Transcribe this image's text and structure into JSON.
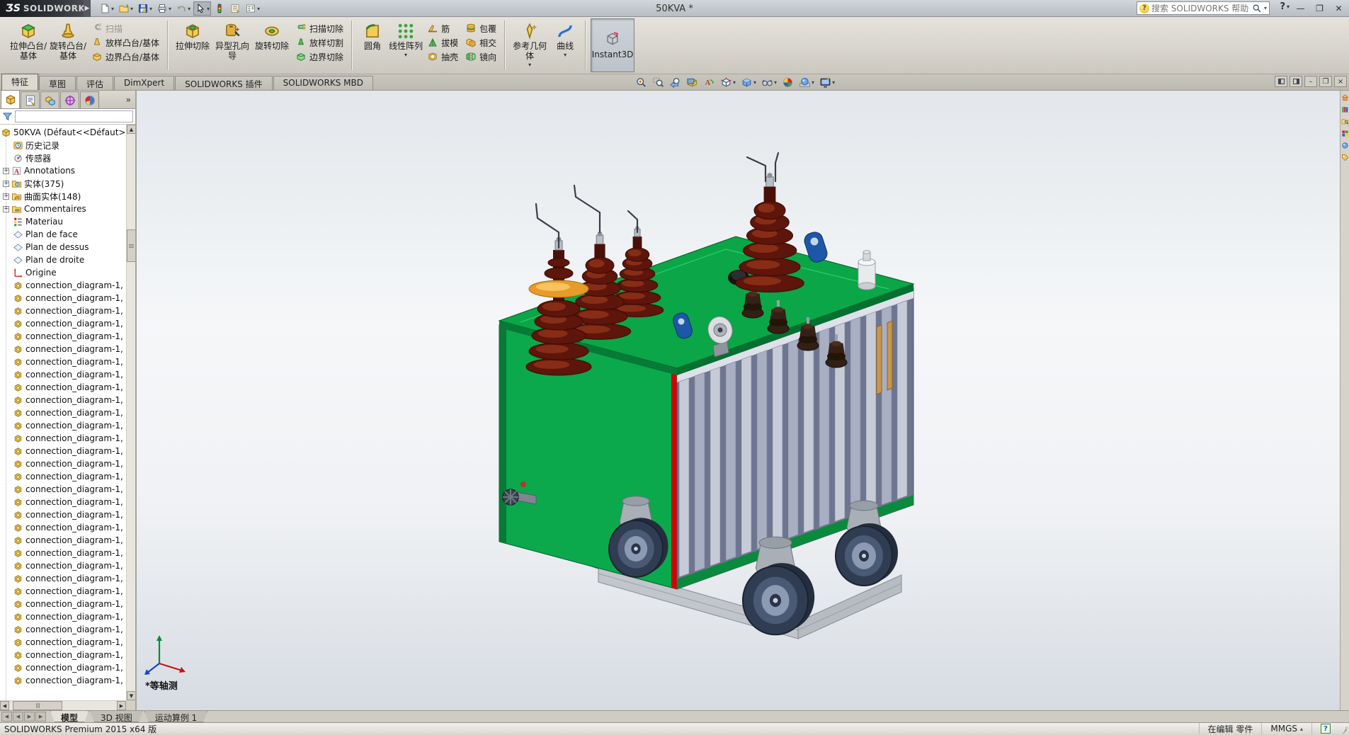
{
  "titlebar": {
    "logo_mark": "ƷS",
    "logo_text": "SOLIDWORKS",
    "title": "50KVA *",
    "tools": [
      {
        "name": "new-document",
        "icon": "new",
        "dropdown": true
      },
      {
        "name": "open",
        "icon": "open",
        "dropdown": true
      },
      {
        "name": "save",
        "icon": "save",
        "dropdown": true
      },
      {
        "name": "print",
        "icon": "print",
        "dropdown": true
      },
      {
        "name": "undo",
        "icon": "undo",
        "dropdown": true
      },
      {
        "name": "select",
        "icon": "select",
        "dropdown": true,
        "pressed": true
      },
      {
        "name": "appearance",
        "icon": "appearance",
        "dropdown": false
      },
      {
        "name": "edit-properties",
        "icon": "props",
        "dropdown": false
      },
      {
        "name": "options",
        "icon": "options",
        "dropdown": true
      }
    ],
    "search": {
      "placeholder": "搜索 SOLIDWORKS 帮助"
    },
    "help_label": "?",
    "window_buttons": [
      "minimize",
      "restore",
      "close"
    ]
  },
  "ribbon": {
    "groups": [
      {
        "big": [
          {
            "label": "拉伸凸台/基体"
          },
          {
            "label": "旋转凸台/基体"
          }
        ],
        "smalls": [
          [
            {
              "label": "扫描",
              "disabled": true
            },
            {
              "label": "放样凸台/基体"
            },
            {
              "label": "边界凸台/基体"
            }
          ]
        ]
      },
      {
        "big": [
          {
            "label": "拉伸切除"
          },
          {
            "label": "异型孔向导"
          },
          {
            "label": "旋转切除"
          }
        ],
        "smalls": [
          [
            {
              "label": "扫描切除"
            },
            {
              "label": "放样切割"
            },
            {
              "label": "边界切除"
            }
          ]
        ]
      },
      {
        "big": [
          {
            "label": "圆角"
          },
          {
            "label": "线性阵列"
          }
        ],
        "smalls": [
          [
            {
              "label": "筋"
            },
            {
              "label": "拔模"
            },
            {
              "label": "抽壳"
            }
          ],
          [
            {
              "label": "包覆"
            },
            {
              "label": "相交"
            },
            {
              "label": "镜向"
            }
          ]
        ]
      },
      {
        "big": [
          {
            "label": "参考几何体"
          },
          {
            "label": "曲线"
          }
        ]
      }
    ],
    "instant3d": {
      "label": "Instant3D",
      "active": true
    }
  },
  "command_tabs": {
    "items": [
      "特征",
      "草图",
      "评估",
      "DimXpert",
      "SOLIDWORKS 插件",
      "SOLIDWORKS MBD"
    ],
    "active_index": 0
  },
  "doc_controls": [
    {
      "name": "pane-left"
    },
    {
      "name": "pane-right"
    },
    {
      "name": "doc-minimize",
      "glyph": "–"
    },
    {
      "name": "doc-restore",
      "glyph": "❐"
    },
    {
      "name": "doc-close",
      "glyph": "×"
    }
  ],
  "feature_panel": {
    "tabs": [
      {
        "name": "featuremanager",
        "icon": "part",
        "active": true
      },
      {
        "name": "propertymanager",
        "icon": "pt-property"
      },
      {
        "name": "configurationmanager",
        "icon": "pt-config"
      },
      {
        "name": "dimxpertmanager",
        "icon": "pt-dimx"
      },
      {
        "name": "displaymanager",
        "icon": "pt-display"
      }
    ],
    "overflow": "»",
    "filter_value": "",
    "root": "50KVA  (Défaut<<Défaut>",
    "items": [
      {
        "label": "历史记录",
        "icon": "history",
        "name": "history"
      },
      {
        "label": "传感器",
        "icon": "sensors",
        "name": "sensors"
      },
      {
        "label": "Annotations",
        "icon": "annotations",
        "name": "annotations",
        "expandable": true
      },
      {
        "label": "实体(375)",
        "icon": "solids",
        "name": "solid-bodies",
        "expandable": true
      },
      {
        "label": "曲面实体(148)",
        "icon": "surfs",
        "name": "surface-bodies",
        "expandable": true
      },
      {
        "label": "Commentaires",
        "icon": "comments",
        "name": "comments",
        "expandable": true
      },
      {
        "label": "Materiau",
        "icon": "material",
        "name": "material"
      },
      {
        "label": "Plan de face",
        "icon": "plane",
        "name": "front-plane"
      },
      {
        "label": "Plan de dessus",
        "icon": "plane",
        "name": "top-plane"
      },
      {
        "label": "Plan de droite",
        "icon": "plane",
        "name": "right-plane"
      },
      {
        "label": "Origine",
        "icon": "origin",
        "name": "origin"
      }
    ],
    "connections": [
      "connection_diagram-1,",
      "connection_diagram-1,",
      "connection_diagram-1,",
      "connection_diagram-1,",
      "connection_diagram-1,",
      "connection_diagram-1,",
      "connection_diagram-1,",
      "connection_diagram-1,",
      "connection_diagram-1,",
      "connection_diagram-1,",
      "connection_diagram-1,",
      "connection_diagram-1,",
      "connection_diagram-1,",
      "connection_diagram-1,",
      "connection_diagram-1,",
      "connection_diagram-1,",
      "connection_diagram-1,",
      "connection_diagram-1,",
      "connection_diagram-1,",
      "connection_diagram-1,",
      "connection_diagram-1,",
      "connection_diagram-1,",
      "connection_diagram-1,",
      "connection_diagram-1,",
      "connection_diagram-1,",
      "connection_diagram-1,",
      "connection_diagram-1,",
      "connection_diagram-1,",
      "connection_diagram-1,",
      "connection_diagram-1,",
      "connection_diagram-1,",
      "connection_diagram-1,"
    ]
  },
  "viewport": {
    "view_label": "*等轴测",
    "headsup": [
      {
        "name": "zoom-to-fit",
        "icon": "zoomfit"
      },
      {
        "name": "zoom-to-area",
        "icon": "zoomarea"
      },
      {
        "name": "previous-view",
        "icon": "prevview"
      },
      {
        "name": "section-view",
        "icon": "section"
      },
      {
        "name": "dynamic-annotation-views",
        "icon": "annview"
      },
      {
        "name": "view-orientation",
        "icon": "vieworient",
        "dropdown": true
      },
      {
        "name": "display-style",
        "icon": "dispstyle",
        "dropdown": true
      },
      {
        "name": "hide-show-items",
        "icon": "hideshow",
        "dropdown": true
      },
      {
        "name": "edit-appearance",
        "icon": "editappear"
      },
      {
        "name": "apply-scene",
        "icon": "applyscene",
        "dropdown": true
      },
      {
        "name": "view-settings",
        "icon": "viewsettings",
        "dropdown": true
      }
    ],
    "model_colors": {
      "tank_green": "#0BA94C",
      "tank_green_dark": "#067A36",
      "top_green": "#0AA647",
      "radiator_light": "#C7CBD8",
      "radiator_mid": "#A9AFC2",
      "radiator_dark": "#6E7590",
      "bushing_maroon": "#5E150B",
      "bushing_highlight": "#8E3119",
      "ring_orange": "#E89B2A",
      "wheel_dark": "#303C52",
      "wheel_rim": "#8C9AB4",
      "frame_gray": "#C2C6CC",
      "lug_blue": "#1C57A8",
      "stripe_red": "#D40000",
      "cone_brown": "#332014"
    }
  },
  "task_pane": [
    {
      "name": "solidworks-resources",
      "icon": "tp-resources"
    },
    {
      "name": "design-library",
      "icon": "tp-library"
    },
    {
      "name": "file-explorer",
      "icon": "tp-explorer"
    },
    {
      "name": "view-palette",
      "icon": "tp-palette"
    },
    {
      "name": "appearances-scenes",
      "icon": "tp-appearances"
    },
    {
      "name": "custom-properties",
      "icon": "tp-props"
    }
  ],
  "bottom_tabs": {
    "nav": [
      "first",
      "previous",
      "next",
      "last"
    ],
    "tabs": [
      "模型",
      "3D 视图",
      "运动算例 1"
    ],
    "active_index": 0
  },
  "statusbar": {
    "product": "SOLIDWORKS Premium 2015 x64 版",
    "mode": "在编辑 零件",
    "units": "MMGS",
    "help": "?"
  }
}
